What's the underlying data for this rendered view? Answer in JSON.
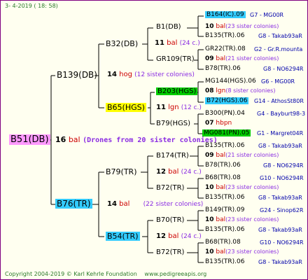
{
  "header": {
    "date": "3-   4-2019  ( 18:  58)"
  },
  "root": {
    "name": "B51(DB)",
    "num": "16",
    "breed": "bal",
    "note": "(Drones from 20 sister colonies)"
  },
  "p": {
    "name": "B139(DB)",
    "num": "14",
    "breed": "hog",
    "note": "(12 sister colonies)"
  },
  "pp": {
    "name": "B32(DB)",
    "num": "11",
    "breed": "bal",
    "note": "(24 c.)"
  },
  "ppp": {
    "name": "B1(DB)",
    "num": "10",
    "breed": "bal",
    "note": "(23 sister colonies)"
  },
  "pppp": {
    "name": "B164(IC).09",
    "tag": "G7 - MG00R"
  },
  "pppm": {
    "name": "B135(TR).06",
    "tag": "G8 - Takab93aR"
  },
  "ppm": {
    "name": "GR109(TR)",
    "num": "09",
    "breed": "bal",
    "note": "(21 sister colonies)"
  },
  "ppmp": {
    "name": "GR22(TR).08",
    "tag": "G2 - Gr.R.mounta"
  },
  "ppmm": {
    "name": "B78(TR).06",
    "tag": "G8 - NO6294R"
  },
  "pm": {
    "name": "B65(HGS)",
    "num": "11",
    "breed": "lgn",
    "note": "(12 c.)"
  },
  "pmp": {
    "name": "B203(HGS)",
    "num": "08",
    "breed": "lgn",
    "note": "(8 sister colonies)"
  },
  "pmpp": {
    "name": "MG144(HGS).06",
    "tag": "G6 - MG00R"
  },
  "pmpm": {
    "name": "B72(HGS).06",
    "tag": "G14 - AthosSt80R"
  },
  "pmm": {
    "name": "B79(HGS)",
    "num": "07",
    "breed": "hbpn"
  },
  "pmmp": {
    "name": "B300(PN).04",
    "tag": "G4 - Bayburt98-3"
  },
  "pmmm": {
    "name": "MG081(PN).05",
    "tag": "G1 - Margret04R"
  },
  "m": {
    "name": "B76(TR)",
    "num": "14",
    "breed": "bal",
    "note": "(22 sister colonies)"
  },
  "mp": {
    "name": "B79(TR)",
    "num": "12",
    "breed": "bal",
    "note": "(24 c.)"
  },
  "mpp": {
    "name": "B174(TR)",
    "num": "09",
    "breed": "bal",
    "note": "(21 sister colonies)"
  },
  "mppp": {
    "name": "B135(TR).06",
    "tag": "G8 - Takab93aR"
  },
  "mppm": {
    "name": "B78(TR).06",
    "tag": "G8 - NO6294R"
  },
  "mpm": {
    "name": "B72(TR)",
    "num": "10",
    "breed": "bal",
    "note": "(23 sister colonies)"
  },
  "mpmp": {
    "name": "B68(TR).08",
    "tag": "G10 - NO6294R"
  },
  "mpmm": {
    "name": "B135(TR).06",
    "tag": "G8 - Takab93aR"
  },
  "mm": {
    "name": "B54(TR)",
    "num": "12",
    "breed": "bal",
    "note": "(24 c.)"
  },
  "mmp": {
    "name": "B70(TR)",
    "num": "10",
    "breed": "bal",
    "note": "(23 sister colonies)"
  },
  "mmpp": {
    "name": "B149(TR).09",
    "tag": "G24 - Sinop62R"
  },
  "mmpm": {
    "name": "B135(TR).06",
    "tag": "G8 - Takab93aR"
  },
  "mmm": {
    "name": "B72(TR)",
    "num": "10",
    "breed": "bal",
    "note": "(23 sister colonies)"
  },
  "mmmp": {
    "name": "B68(TR).08",
    "tag": "G10 - NO6294R"
  },
  "mmmm": {
    "name": "B135(TR).06",
    "tag": "G8 - Takab93aR"
  },
  "footer": {
    "copyright": "Copyright 2004-2019 © Karl Kehrle Foundation",
    "url": "www.pedigreeapis.org"
  },
  "colors": {
    "line": "#000000",
    "num": "#000000",
    "breed": "#cc0000",
    "note": "#8a2be2",
    "tag": "#0000aa",
    "hl_root": "#ff99ff",
    "hl_cyan": "#33ccff",
    "hl_yellow": "#ffff00",
    "hl_green": "#00cc00"
  }
}
